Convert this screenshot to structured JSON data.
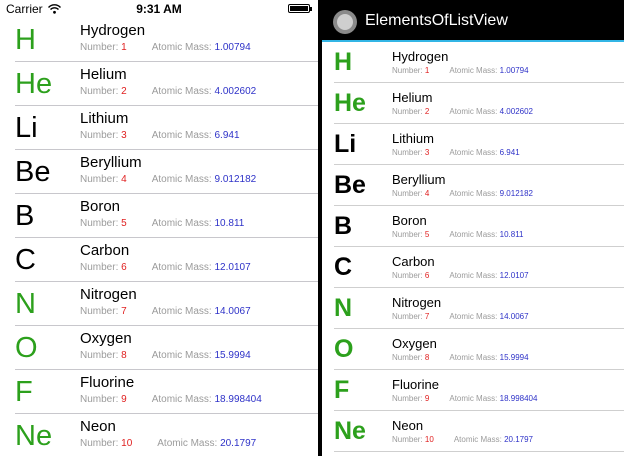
{
  "ios": {
    "status": {
      "carrier": "Carrier",
      "time": "9:31 AM"
    },
    "number_label": "Number:",
    "mass_label": "Atomic Mass:",
    "items": [
      {
        "symbol": "H",
        "name": "Hydrogen",
        "number": "1",
        "mass": "1.00794",
        "color": "#2ca01c"
      },
      {
        "symbol": "He",
        "name": "Helium",
        "number": "2",
        "mass": "4.002602",
        "color": "#2ca01c"
      },
      {
        "symbol": "Li",
        "name": "Lithium",
        "number": "3",
        "mass": "6.941",
        "color": "#000000"
      },
      {
        "symbol": "Be",
        "name": "Beryllium",
        "number": "4",
        "mass": "9.012182",
        "color": "#000000"
      },
      {
        "symbol": "B",
        "name": "Boron",
        "number": "5",
        "mass": "10.811",
        "color": "#000000"
      },
      {
        "symbol": "C",
        "name": "Carbon",
        "number": "6",
        "mass": "12.0107",
        "color": "#000000"
      },
      {
        "symbol": "N",
        "name": "Nitrogen",
        "number": "7",
        "mass": "14.0067",
        "color": "#2ca01c"
      },
      {
        "symbol": "O",
        "name": "Oxygen",
        "number": "8",
        "mass": "15.9994",
        "color": "#2ca01c"
      },
      {
        "symbol": "F",
        "name": "Fluorine",
        "number": "9",
        "mass": "18.998404",
        "color": "#2ca01c"
      },
      {
        "symbol": "Ne",
        "name": "Neon",
        "number": "10",
        "mass": "20.1797",
        "color": "#2ca01c"
      }
    ]
  },
  "android": {
    "title": "ElementsOfListView",
    "number_label": "Number:",
    "mass_label": "Atomic Mass:",
    "items": [
      {
        "symbol": "H",
        "name": "Hydrogen",
        "number": "1",
        "mass": "1.00794",
        "color": "#2ca01c"
      },
      {
        "symbol": "He",
        "name": "Helium",
        "number": "2",
        "mass": "4.002602",
        "color": "#2ca01c"
      },
      {
        "symbol": "Li",
        "name": "Lithium",
        "number": "3",
        "mass": "6.941",
        "color": "#000000"
      },
      {
        "symbol": "Be",
        "name": "Beryllium",
        "number": "4",
        "mass": "9.012182",
        "color": "#000000"
      },
      {
        "symbol": "B",
        "name": "Boron",
        "number": "5",
        "mass": "10.811",
        "color": "#000000"
      },
      {
        "symbol": "C",
        "name": "Carbon",
        "number": "6",
        "mass": "12.0107",
        "color": "#000000"
      },
      {
        "symbol": "N",
        "name": "Nitrogen",
        "number": "7",
        "mass": "14.0067",
        "color": "#2ca01c"
      },
      {
        "symbol": "O",
        "name": "Oxygen",
        "number": "8",
        "mass": "15.9994",
        "color": "#2ca01c"
      },
      {
        "symbol": "F",
        "name": "Fluorine",
        "number": "9",
        "mass": "18.998404",
        "color": "#2ca01c"
      },
      {
        "symbol": "Ne",
        "name": "Neon",
        "number": "10",
        "mass": "20.1797",
        "color": "#2ca01c"
      }
    ]
  }
}
